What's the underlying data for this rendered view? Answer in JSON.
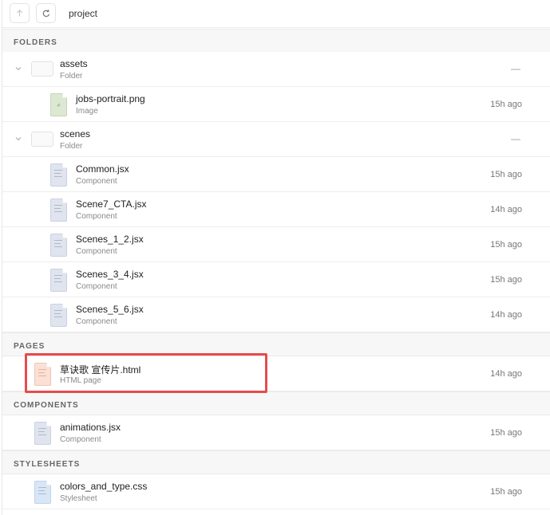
{
  "toolbar": {
    "up_icon": "arrow-up-icon",
    "refresh_icon": "refresh-icon",
    "path_label": "project"
  },
  "sections": {
    "folders": "FOLDERS",
    "pages": "PAGES",
    "components": "COMPONENTS",
    "stylesheets": "STYLESHEETS"
  },
  "folders": [
    {
      "name": "assets",
      "type": "Folder",
      "time": "—",
      "children": [
        {
          "name": "jobs-portrait.png",
          "type": "Image",
          "time": "15h ago",
          "icon": "image-file-icon"
        }
      ]
    },
    {
      "name": "scenes",
      "type": "Folder",
      "time": "—",
      "children": [
        {
          "name": "Common.jsx",
          "type": "Component",
          "time": "15h ago",
          "icon": "component-file-icon"
        },
        {
          "name": "Scene7_CTA.jsx",
          "type": "Component",
          "time": "14h ago",
          "icon": "component-file-icon"
        },
        {
          "name": "Scenes_1_2.jsx",
          "type": "Component",
          "time": "15h ago",
          "icon": "component-file-icon"
        },
        {
          "name": "Scenes_3_4.jsx",
          "type": "Component",
          "time": "15h ago",
          "icon": "component-file-icon"
        },
        {
          "name": "Scenes_5_6.jsx",
          "type": "Component",
          "time": "14h ago",
          "icon": "component-file-icon"
        }
      ]
    }
  ],
  "pages": [
    {
      "name": "草诀歌 宣传片.html",
      "type": "HTML page",
      "time": "14h ago",
      "icon": "html-file-icon"
    }
  ],
  "components": [
    {
      "name": "animations.jsx",
      "type": "Component",
      "time": "15h ago",
      "icon": "component-file-icon"
    }
  ],
  "stylesheets": [
    {
      "name": "colors_and_type.css",
      "type": "Stylesheet",
      "time": "15h ago",
      "icon": "stylesheet-file-icon"
    }
  ],
  "colors": {
    "highlight": "#e74b4b",
    "component_icon": "#dfe4ef",
    "image_icon": "#dde8d3",
    "html_icon": "#fbe0d5",
    "css_icon": "#d9e6f6"
  }
}
